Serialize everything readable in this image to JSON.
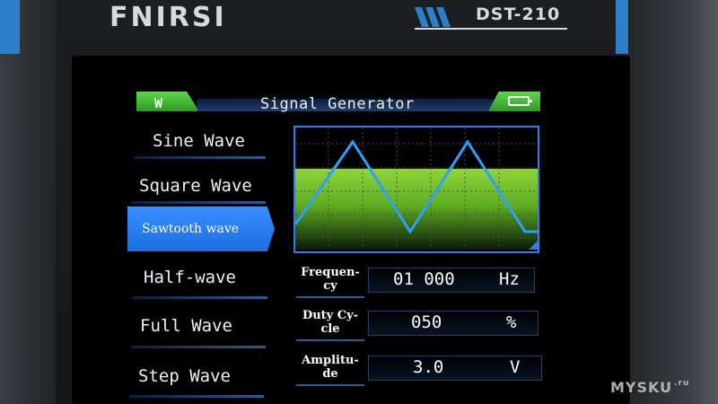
{
  "device": {
    "brand": "FNIRSI",
    "model": "DST-210"
  },
  "header": {
    "title": "Signal Generator",
    "wave_icon": "W",
    "battery_icon": "battery-icon"
  },
  "menu": {
    "items": [
      {
        "label": "Sine Wave"
      },
      {
        "label": "Square Wave"
      },
      {
        "label": "Sawtooth wave",
        "selected": true
      },
      {
        "label": "Half-wave"
      },
      {
        "label": "Full Wave"
      },
      {
        "label": "Step Wave"
      }
    ]
  },
  "params": {
    "frequency": {
      "label_1": "Frequen-",
      "label_2": "cy",
      "value": "01 000",
      "unit": "Hz"
    },
    "duty_cycle": {
      "label_1": "Duty Cy-",
      "label_2": "cle",
      "value": "050",
      "unit": "%"
    },
    "amplitude": {
      "label_1": "Amplitu-",
      "label_2": "de",
      "value": "3.0",
      "unit": "V"
    }
  },
  "watermark": {
    "text": "MYSKU",
    "suffix": ".ru"
  },
  "colors": {
    "accent": "#3a8eff",
    "header_green": "#4cc23c",
    "wave_line": "#2f9fff",
    "wave_fill": "#6fbf2a"
  }
}
